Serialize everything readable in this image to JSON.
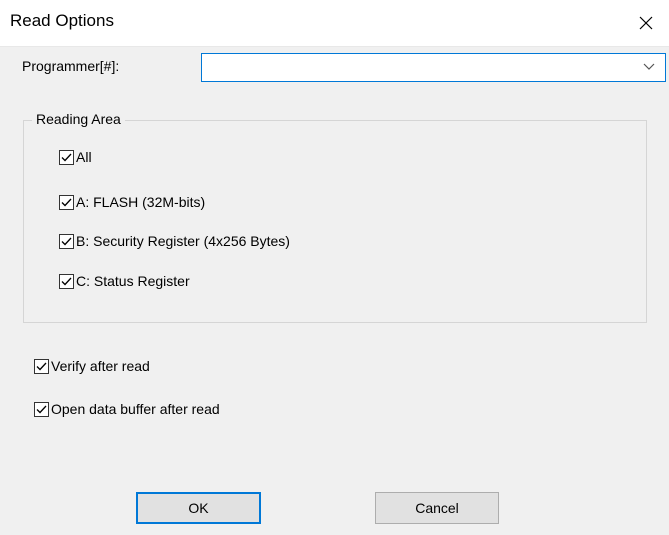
{
  "window": {
    "title": "Read Options",
    "close_icon": "close-icon"
  },
  "programmer": {
    "label": "Programmer[#]:",
    "value": "",
    "dropdown_icon": "chevron-down-icon"
  },
  "reading_area": {
    "title": "Reading Area",
    "options": [
      {
        "label": "All",
        "checked": true
      },
      {
        "label": "A: FLASH (32M-bits)",
        "checked": true
      },
      {
        "label": "B: Security Register (4x256 Bytes)",
        "checked": true
      },
      {
        "label": "C: Status Register",
        "checked": true
      }
    ]
  },
  "options": {
    "verify_after_read": {
      "label": "Verify after read",
      "checked": true
    },
    "open_buffer_after_read": {
      "label": "Open data buffer after read",
      "checked": true
    }
  },
  "buttons": {
    "ok": "OK",
    "cancel": "Cancel"
  },
  "colors": {
    "accent": "#0078d7",
    "dialog_background": "#f0f0f0",
    "button_face": "#e1e1e1"
  }
}
